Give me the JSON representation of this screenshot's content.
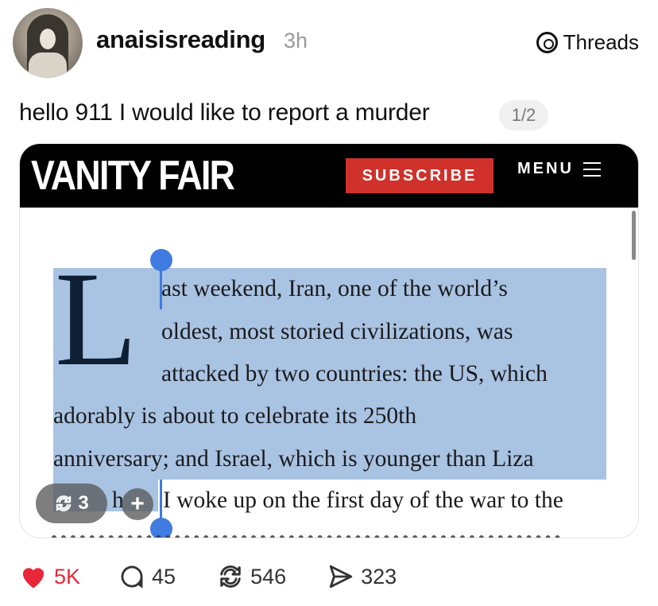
{
  "post": {
    "username": "anaisisreading",
    "time": "3h",
    "platform_label": "Threads",
    "text": "hello 911 I would like to report a murder",
    "page_indicator": "1/2"
  },
  "article": {
    "header": {
      "logo": "VANITY FAIR",
      "subscribe_label": "SUBSCRIBE",
      "menu_label": "MENU"
    },
    "drop_cap": "L",
    "lines": [
      "ast weekend, Iran, one of the world’s",
      "oldest, most storied civilizations, was",
      "attacked by two countries: the US, which",
      "adorably is about to celebrate its 250th",
      "anniversary; and Israel, which is younger than Liza",
      "I woke up on the first day of the war to the"
    ],
    "fragment": "h"
  },
  "overlay": {
    "repost_count": "3",
    "plus": "+"
  },
  "actions": {
    "likes": "5K",
    "comments": "45",
    "reposts": "546",
    "shares": "323"
  },
  "colors": {
    "like_red": "#e8283a",
    "selection_blue": "#a9c3e3",
    "handle_blue": "#3f7be0",
    "subscribe_red": "#d0312b"
  }
}
